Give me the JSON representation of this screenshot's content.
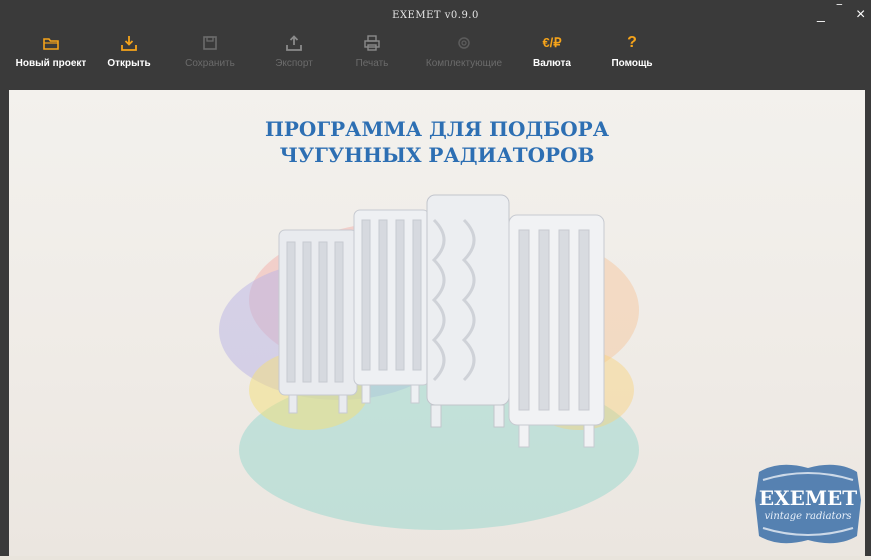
{
  "window": {
    "title": "EXEMET v0.9.0",
    "controls": {
      "minimize": "_",
      "restore": "‾",
      "close": "×"
    }
  },
  "toolbar": {
    "items": [
      {
        "label": "Новый проект",
        "icon": "folder-icon",
        "enabled": true
      },
      {
        "label": "Открыть",
        "icon": "download-icon",
        "enabled": true
      },
      {
        "label": "Сохранить",
        "icon": "save-icon",
        "enabled": false
      },
      {
        "label": "Экспорт",
        "icon": "upload-icon",
        "enabled": false
      },
      {
        "label": "Печать",
        "icon": "printer-icon",
        "enabled": false
      },
      {
        "label": "Комплектующие",
        "icon": "gear-icon",
        "enabled": false
      },
      {
        "label": "Валюта",
        "icon": "currency-icon",
        "enabled": true,
        "icon_text": "€/₽"
      },
      {
        "label": "Помощь",
        "icon": "help-icon",
        "enabled": true,
        "icon_text": "?"
      }
    ]
  },
  "main": {
    "headline_line1": "ПРОГРАММА ДЛЯ ПОДБОРА",
    "headline_line2": "ЧУГУННЫХ РАДИАТОРОВ",
    "logo_text": "EXEMET",
    "logo_subtitle": "vintage radiators"
  },
  "colors": {
    "accent": "#f5a31a",
    "brand_blue": "#2d6fb3",
    "titlebar": "#3a3a3a",
    "disabled_text": "#6b6b6b"
  }
}
